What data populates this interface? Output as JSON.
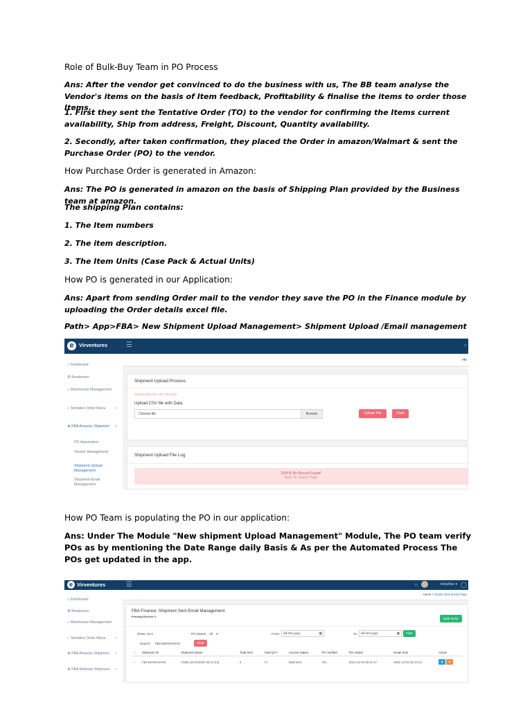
{
  "doc": {
    "heading1": "Role of Bulk-Buy Team in PO Process",
    "para1": "Ans: After the vendor get convinced to do the business with us, The BB team analyse the Vendor's items on the basis of Item feedback, Profitability & finalise the items to order those Items.",
    "para2": "1. First they sent the Tentative Order (TO) to the vendor for confirming the Items current availability, Ship from address, Freight, Discount, Quantity availability.",
    "para3": "2. Secondly, after taken confirmation, they placed the Order in amazon/Walmart & sent the Purchase Order (PO) to the vendor.",
    "heading2": "How Purchase Order is generated in Amazon:",
    "para4": "Ans: The PO is generated in amazon on the basis of Shipping Plan provided by the Business team at amazon.",
    "para5": "The shipping Plan contains:",
    "list1": "1. The Item numbers",
    "list2": "2. The item description.",
    "list3": "3. The Item Units (Case Pack & Actual Units)",
    "heading3": "How PO is generated in our Application:",
    "para6": "Ans: Apart from sending Order mail to the vendor they save the PO in the Finance module by uploading the Order details excel file.",
    "path": "Path> App>FBA> New Shipment Upload Management> Shipment Upload /Email management",
    "heading4": "How PO Team is populating the PO in our application:",
    "para7": "Ans: Under The Module \"New shipment Upload Management\" Module, The PO team verify POs as by mentioning the Date Range daily Basis & As per the Automated Process The POs get updated in the app."
  },
  "shot1": {
    "brand": "Virventures",
    "breadcrumb": "Ho",
    "sidebar": [
      "Dashboard",
      "Breakeven",
      "Warehouse Management",
      "Tentative Order Menu",
      "FBA Amazon Shipment",
      "PO Automation",
      "Vendor Management",
      "Shipment Upload Management",
      "Shipment Email Management"
    ],
    "upload_title": "Shipment Upload Process",
    "download_link": "Download your CSV file here",
    "csv_label": "Upload CSV file with Data:",
    "choose_file": "Choose file",
    "browse": "Browse",
    "upload_btn": "Upload File",
    "clear_btn": "Clear",
    "log_title": "Shipment Upload File Log",
    "empty_msg": "OOPS! No Record Found!",
    "empty_link": "Back To Search Page"
  },
  "shot2": {
    "brand": "Virventures",
    "user": "rishadhar",
    "breadcrumb_home": "Home",
    "breadcrumb_page": "Vendor Sent Email Page",
    "sidebar": [
      "Dashboard",
      "Breakeven",
      "Warehouse Management",
      "Tentative Order Menu",
      "FBA Amazon Shipment",
      "FBA Walmart Shipment"
    ],
    "title": "FBA Finance: Shipment Sent Email Management",
    "pending": "Pending Record: 0",
    "bulk_verify": "Bulk Verify",
    "show_label": "Show:",
    "show_value": "10",
    "status_label": "PO Status:",
    "status_value": "All",
    "from_label": "From:",
    "to_label": "To:",
    "date_placeholder": "dd-mm-yyyy",
    "filter_btn": "Filter",
    "search_label": "Search:",
    "search_value": "FBA16HRAVAHG",
    "clear_btn": "Clear",
    "columns": [
      "Shipment ID",
      "Shipment Name",
      "Total SKU",
      "Total QTY",
      "Current Status",
      "PO Verified",
      "PO Added",
      "Email Sent",
      "Action"
    ],
    "row": [
      "FBA16HRAVAHG",
      "CN55 (11/10/2021 05:11:24)",
      "5",
      "71",
      "Mail Sent",
      "Yes",
      "2021-12-03 05:11:27",
      "2021-12-03 05:12:34"
    ]
  },
  "colors": {
    "navy": "#123e66",
    "danger": "#f06a75",
    "success": "#29b674",
    "info": "#2a9fd8",
    "warning": "#f08a4a"
  }
}
